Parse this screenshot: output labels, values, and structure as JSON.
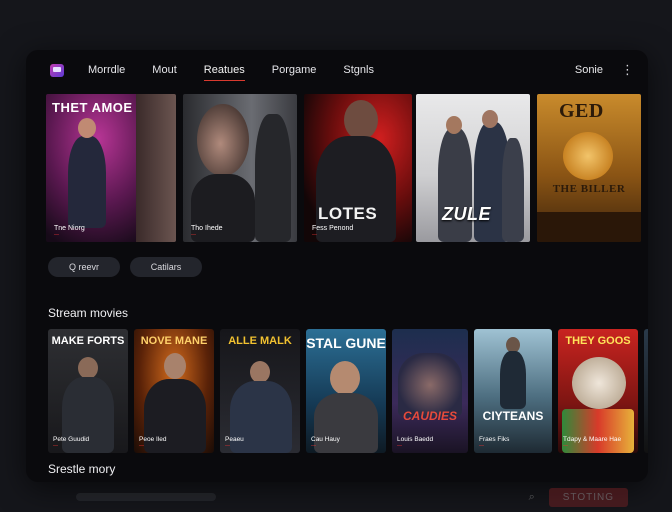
{
  "nav": {
    "items": [
      "Morrdle",
      "Mout",
      "Reatues",
      "Porgame",
      "Stgnls"
    ],
    "active_index": 2,
    "signin": "Sonie",
    "more_icon": "kebab-menu-icon"
  },
  "hero": [
    {
      "title": "THET AMOE",
      "caption": "Tne Niorg",
      "sub": "—"
    },
    {
      "title": "",
      "caption": "Tho Ihede",
      "sub": "—"
    },
    {
      "title": "LOTES",
      "caption": "Fess Penond",
      "sub": "—"
    },
    {
      "title": "ZULE",
      "caption": "",
      "sub": ""
    },
    {
      "title_top": "GED",
      "title_bottom": "THE BILLER",
      "caption": "",
      "sub": ""
    }
  ],
  "pills": {
    "left": "Q reevr",
    "right": "Catilars"
  },
  "sections": {
    "row1": "Stream movies",
    "row2": "Srestle mory"
  },
  "posters": [
    {
      "title": "MAKE FORTS",
      "caption": "Pete Guudid",
      "sub": "—"
    },
    {
      "title": "NOVE MANE",
      "caption": "Peoe Iled",
      "sub": "—"
    },
    {
      "title": "ALLE MALK",
      "caption": "Peaeu",
      "sub": "—"
    },
    {
      "title": "STAL GUNE",
      "caption": "Cau Hauy",
      "sub": "—"
    },
    {
      "title": "CAUDIES",
      "caption": "Louis Baedd",
      "sub": "—"
    },
    {
      "title": "CIYTEANS",
      "caption": "Fraes Fiks",
      "sub": "—"
    },
    {
      "title": "THEY GOOS",
      "caption": "Tdapy & Maare Hae",
      "sub": "—"
    }
  ],
  "bottom": {
    "search_icon": "search-icon",
    "start_label": "STOTING"
  },
  "colors": {
    "accent": "#d93a2f",
    "background": "#0a0a0d",
    "pill": "#23252c"
  }
}
